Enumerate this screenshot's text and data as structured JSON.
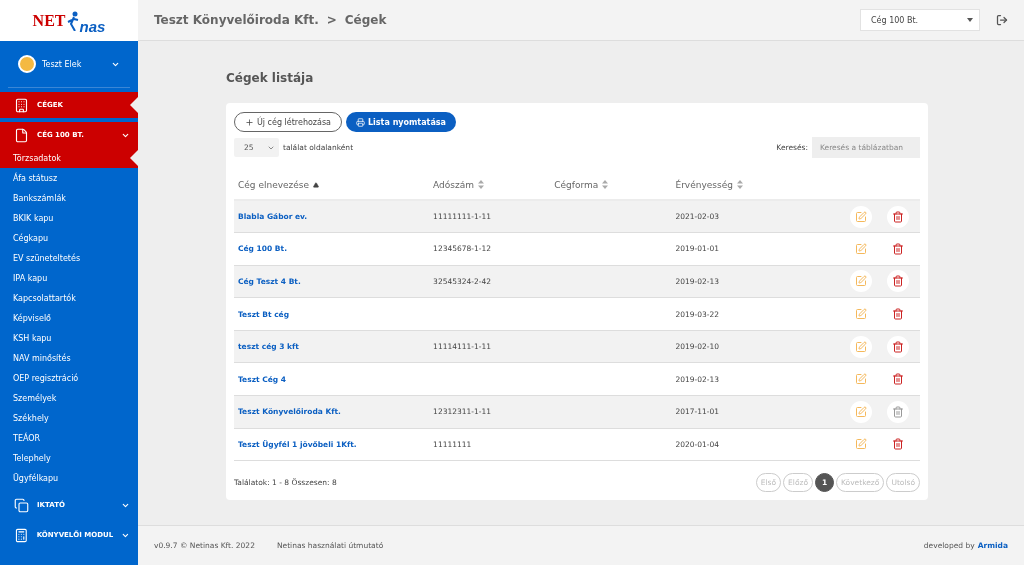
{
  "logo": {
    "part_1": "NET",
    "part_2": "nas"
  },
  "user": {
    "name": "Teszt Elek",
    "expanded": false
  },
  "sidebar": {
    "items": [
      {
        "label": "CÉGEK",
        "selected": true,
        "has_caret": false
      },
      {
        "label": "CÉG 100 BT.",
        "selected": true,
        "has_caret": true,
        "children": [
          {
            "label": "Törzsadatok",
            "selected": true
          },
          {
            "label": "Áfa státusz",
            "selected": false
          },
          {
            "label": "Bankszámlák",
            "selected": false
          },
          {
            "label": "BKIK kapu",
            "selected": false
          },
          {
            "label": "Cégkapu",
            "selected": false
          },
          {
            "label": "EV szüneteltetés",
            "selected": false
          },
          {
            "label": "IPA kapu",
            "selected": false
          },
          {
            "label": "Kapcsolattartók",
            "selected": false
          },
          {
            "label": "Képviselő",
            "selected": false
          },
          {
            "label": "KSH kapu",
            "selected": false
          },
          {
            "label": "NAV minősítés",
            "selected": false
          },
          {
            "label": "OEP regisztráció",
            "selected": false
          },
          {
            "label": "Személyek",
            "selected": false
          },
          {
            "label": "Székhely",
            "selected": false
          },
          {
            "label": "TEÁOR",
            "selected": false
          },
          {
            "label": "Telephely",
            "selected": false
          },
          {
            "label": "Ügyfélkapu",
            "selected": false
          }
        ]
      },
      {
        "label": "IKTATÓ",
        "selected": false,
        "has_caret": true
      },
      {
        "label": "KÖNYVELŐI MODUL",
        "selected": false,
        "has_caret": true
      }
    ]
  },
  "topbar": {
    "breadcrumb": [
      "Teszt Könyvelőiroda Kft.",
      "Cégek"
    ],
    "separator": ">",
    "company_select": "Cég 100 Bt."
  },
  "page_title": "Cégek listája",
  "toolbar": {
    "new_button": "Új cég létrehozása",
    "print_button": "Lista nyomtatása",
    "page_size": "25",
    "page_size_label": "találat oldalanként",
    "search_label": "Keresés:",
    "search_placeholder": "Keresés a táblázatban"
  },
  "table": {
    "columns": [
      {
        "label": "Cég elnevezése",
        "sorted": true
      },
      {
        "label": "Adószám",
        "sorted": false
      },
      {
        "label": "Cégforma",
        "sorted": false
      },
      {
        "label": "Érvényesség",
        "sorted": false
      }
    ],
    "rows": [
      {
        "name": "Blabla Gábor ev.",
        "tax_id": "11111111-1-11",
        "valid": "2021-02-03",
        "delete_disabled": false
      },
      {
        "name": "Cég 100 Bt.",
        "tax_id": "12345678-1-12",
        "valid": "2019-01-01",
        "delete_disabled": false
      },
      {
        "name": "Cég Teszt 4 Bt.",
        "tax_id": "32545324-2-42",
        "valid": "2019-02-13",
        "delete_disabled": false
      },
      {
        "name": "Teszt Bt cég",
        "valid": "2019-03-22",
        "delete_disabled": false
      },
      {
        "name": "teszt cég 3 kft",
        "tax_id": "11114111-1-11",
        "valid": "2019-02-10",
        "delete_disabled": false
      },
      {
        "name": "Teszt Cég 4",
        "valid": "2019-02-13",
        "delete_disabled": false
      },
      {
        "name": "Teszt Könyvelőiroda Kft.",
        "tax_id": "12312311-1-11",
        "valid": "2017-11-01",
        "delete_disabled": true
      },
      {
        "name": "Teszt Ügyfél 1 jövőbeli 1Kft.",
        "tax_id": "11111111",
        "valid": "2020-01-04",
        "delete_disabled": false
      }
    ]
  },
  "summary": "Találatok: 1 - 8 Összesen: 8",
  "pagination": [
    {
      "label": "Első",
      "selected": false,
      "disabled": true
    },
    {
      "label": "Előző",
      "selected": false,
      "disabled": true
    },
    {
      "label": "1",
      "selected": true,
      "disabled": false
    },
    {
      "label": "Következő",
      "selected": false,
      "disabled": true
    },
    {
      "label": "Utolsó",
      "selected": false,
      "disabled": true
    }
  ],
  "footer": {
    "version": "v0.9.7 © Netinas Kft. 2022",
    "guide_link": "Netinas használati útmutató",
    "developed_by": "developed by",
    "developer": "Armida"
  }
}
